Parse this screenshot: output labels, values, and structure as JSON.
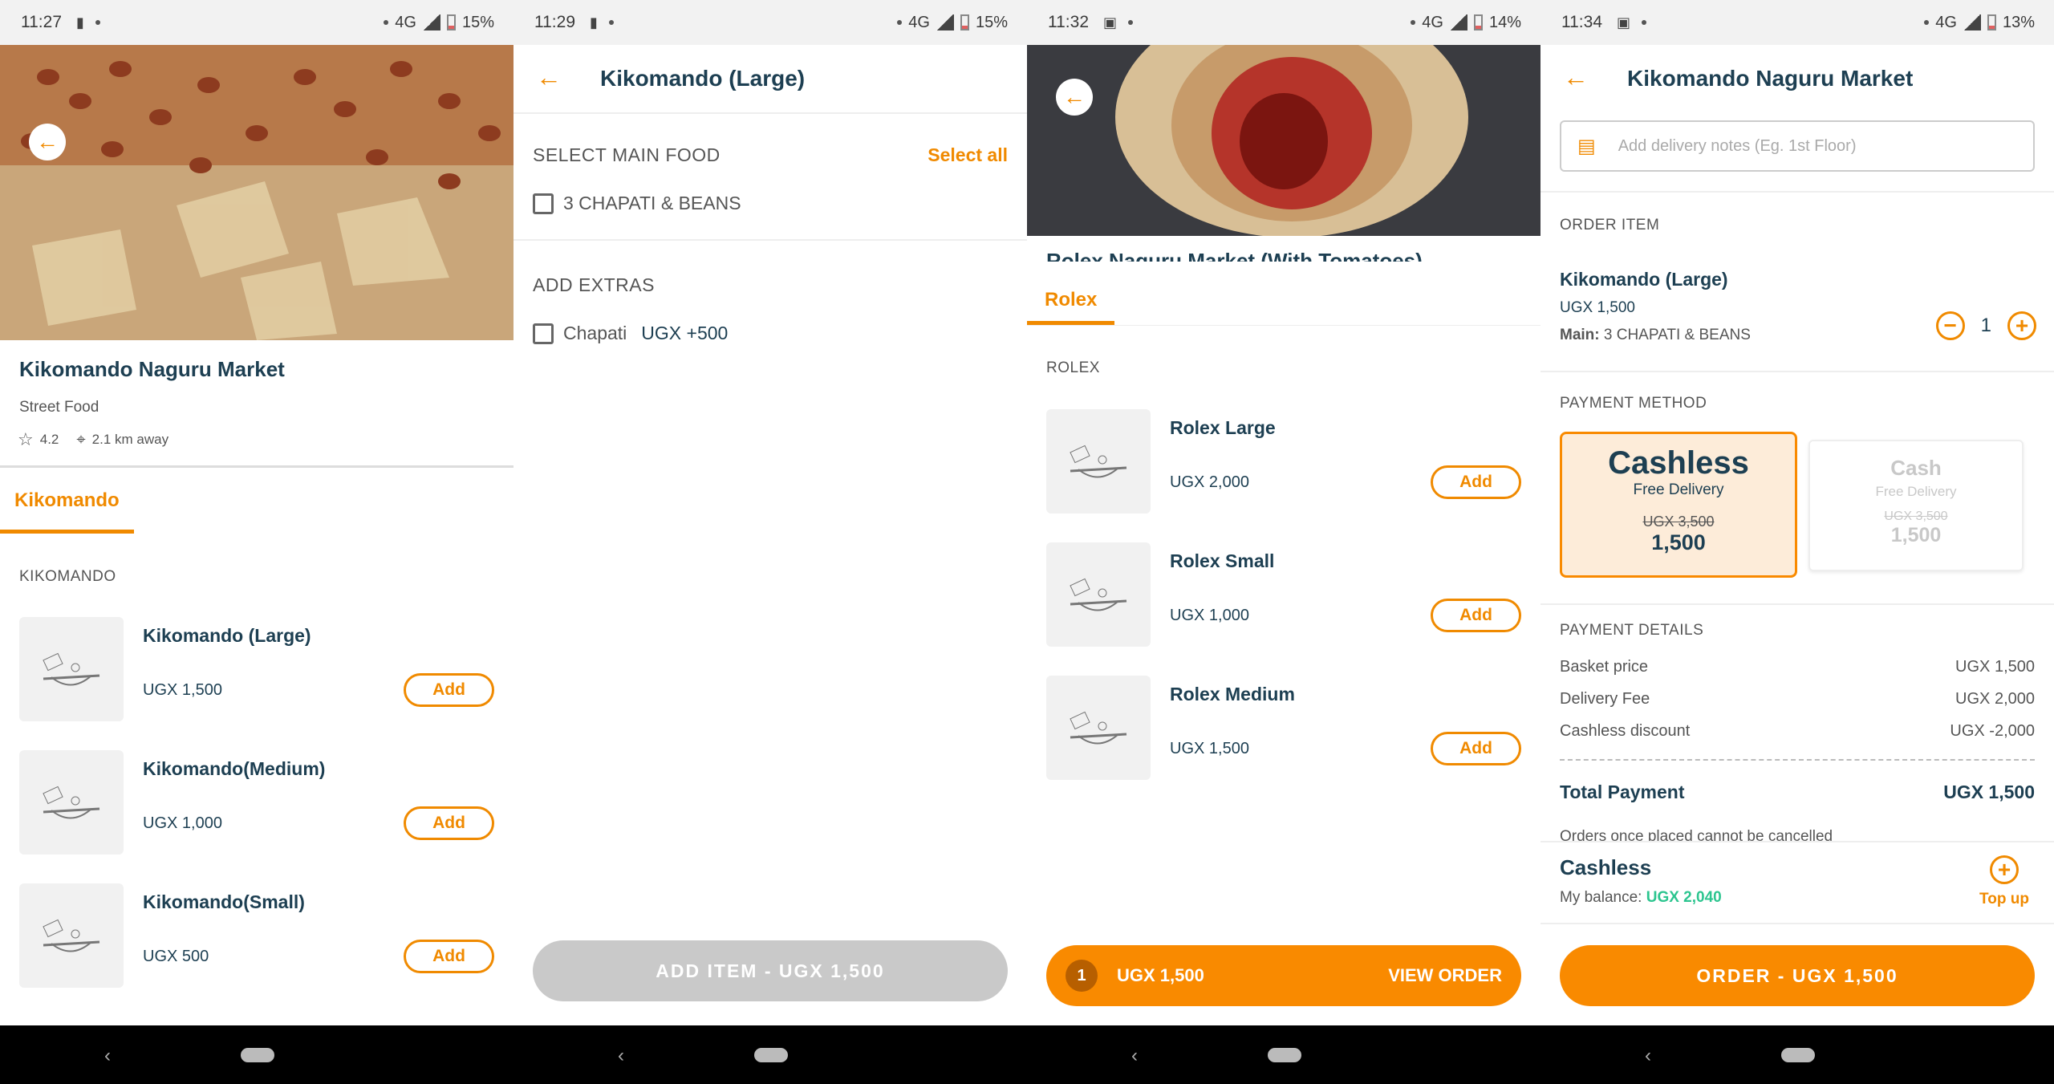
{
  "colors": {
    "accent": "#f98a00",
    "text": "#1d3f52",
    "green": "#2cc58f"
  },
  "screen1": {
    "status": {
      "time": "11:27",
      "network": "4G",
      "battery": "15%"
    },
    "restaurant": {
      "name": "Kikomando Naguru Market",
      "category": "Street Food",
      "rating": "4.2",
      "distance": "2.1 km away"
    },
    "tab": "Kikomando",
    "section": "KIKOMANDO",
    "items": [
      {
        "name": "Kikomando (Large)",
        "price": "UGX 1,500",
        "add": "Add"
      },
      {
        "name": "Kikomando(Medium)",
        "price": "UGX 1,000",
        "add": "Add"
      },
      {
        "name": "Kikomando(Small)",
        "price": "UGX 500",
        "add": "Add"
      }
    ]
  },
  "screen2": {
    "status": {
      "time": "11:29",
      "network": "4G",
      "battery": "15%"
    },
    "title": "Kikomando (Large)",
    "main_label": "SELECT MAIN FOOD",
    "select_all": "Select all",
    "main_option": "3 CHAPATI & BEANS",
    "extras_label": "ADD EXTRAS",
    "extra_name": "Chapati",
    "extra_price": "UGX +500",
    "add_button": "ADD ITEM - UGX 1,500"
  },
  "screen3": {
    "status": {
      "time": "11:32",
      "network": "4G",
      "battery": "14%"
    },
    "partial_title": "Rolex Naguru Market (With Tomatoes)",
    "tab": "Rolex",
    "section": "ROLEX",
    "items": [
      {
        "name": "Rolex Large",
        "price": "UGX 2,000",
        "add": "Add"
      },
      {
        "name": "Rolex Small",
        "price": "UGX 1,000",
        "add": "Add"
      },
      {
        "name": "Rolex Medium",
        "price": "UGX 1,500",
        "add": "Add"
      }
    ],
    "cart": {
      "count": "1",
      "total": "UGX 1,500",
      "action": "VIEW ORDER"
    }
  },
  "screen4": {
    "status": {
      "time": "11:34",
      "network": "4G",
      "battery": "13%"
    },
    "title": "Kikomando Naguru Market",
    "notes_placeholder": "Add delivery notes (Eg. 1st Floor)",
    "order_item_label": "ORDER ITEM",
    "order_item": {
      "name": "Kikomando (Large)",
      "price": "UGX 1,500",
      "main_key": "Main:",
      "main_value": "3 CHAPATI & BEANS",
      "qty": "1"
    },
    "payment_method_label": "PAYMENT METHOD",
    "cashless": {
      "brand": "Cashless",
      "delivery": "Free Delivery",
      "old_price": "UGX 3,500",
      "price": "1,500"
    },
    "cash": {
      "label": "Cash",
      "delivery": "Free Delivery",
      "old_price": "UGX 3,500",
      "price": "1,500"
    },
    "payment_details_label": "PAYMENT DETAILS",
    "details": [
      {
        "label": "Basket price",
        "value": "UGX 1,500"
      },
      {
        "label": "Delivery Fee",
        "value": "UGX 2,000"
      },
      {
        "label": "Cashless discount",
        "value": "UGX -2,000"
      }
    ],
    "total_label": "Total Payment",
    "total_value": "UGX 1,500",
    "notice": "Orders once placed cannot be cancelled",
    "wallet": {
      "brand": "Cashless",
      "balance_label": "My balance:",
      "balance": "UGX 2,040",
      "topup": "Top up"
    },
    "order_button": "ORDER - UGX 1,500"
  }
}
